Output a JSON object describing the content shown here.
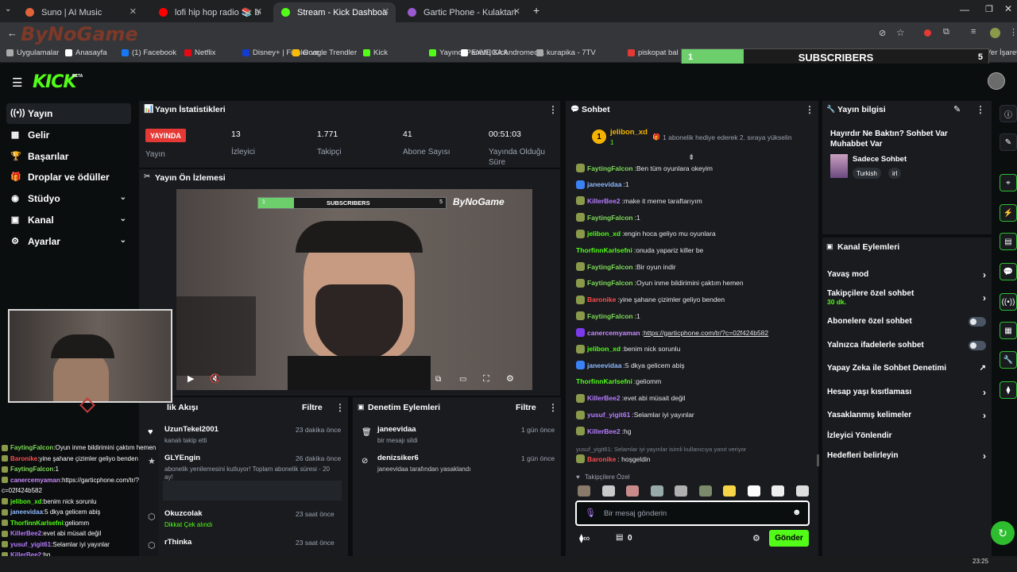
{
  "browser": {
    "tabs": [
      {
        "label": "Suno | AI Music",
        "color": "#e0633a"
      },
      {
        "label": "lofi hip hop radio 📚 beats",
        "color": "#ff0000"
      },
      {
        "label": "Stream - Kick Dashboard",
        "color": "#53fc18"
      },
      {
        "label": "Gartic Phone - Kulaktan Kulağa",
        "color": "#9b59d0"
      }
    ],
    "watermark": "ByNoGame",
    "bookmarks": [
      "Uygulamalar",
      "Anasayfa",
      "(1) Facebook",
      "Netflix",
      "Disney+ | Filmler ve...",
      "Google Trendler",
      "Kick",
      "Yayıncı Paneli | Kick",
      "EXVEGA Andromed...",
      "kurapika - 7TV",
      "piskopat bal pe...",
      "Gelecek ...",
      "Tüm Yer İşaretleri"
    ]
  },
  "sub_goal": {
    "current": "1",
    "label": "SUBSCRIBERS",
    "target": "5",
    "progress": 0.2
  },
  "nav": {
    "logo": "KICK",
    "beta": "BETA"
  },
  "sidebar": [
    {
      "label": "Yayın",
      "icon": "broadcast-icon",
      "glyph": "((•))",
      "active": true
    },
    {
      "label": "Gelir",
      "icon": "revenue-icon",
      "glyph": "▦"
    },
    {
      "label": "Başarılar",
      "icon": "trophy-icon",
      "glyph": "🏆"
    },
    {
      "label": "Droplar ve ödüller",
      "icon": "gift-icon",
      "glyph": "🎁"
    },
    {
      "label": "Stüdyo",
      "icon": "studio-icon",
      "glyph": "◉",
      "chev": true
    },
    {
      "label": "Kanal",
      "icon": "channel-icon",
      "glyph": "▣",
      "chev": true
    },
    {
      "label": "Ayarlar",
      "icon": "settings-icon",
      "glyph": "⚙",
      "chev": true
    }
  ],
  "stats": {
    "title": "Yayın İstatistikleri",
    "live_badge": "YAYINDA",
    "live_label": "Yayın",
    "items": [
      {
        "value": "13",
        "label": "İzleyici"
      },
      {
        "value": "1.771",
        "label": "Takipçi"
      },
      {
        "value": "41",
        "label": "Abone Sayısı"
      },
      {
        "value": "00:51:03",
        "label": "Yayında Olduğu Süre"
      }
    ]
  },
  "preview": {
    "title": "Yayın Ön İzlemesi"
  },
  "activity": {
    "title": "Etkinlik Akışı",
    "title_visible": "lik Akışı",
    "filter": "Filtre",
    "items": [
      {
        "name": "UzunTekel2001",
        "sub": "kanalı takip etti",
        "time": "23 dakika önce",
        "icon": "heart-icon"
      },
      {
        "name": "GLYEngin",
        "sub": "abonelik yenilemesini kutluyor! Toplam abonelik süresi - 20 ay!",
        "time": "26 dakika önce",
        "icon": "star-icon"
      },
      {
        "name": "Okuzcolak",
        "sub": "Dikkat Çek alındı",
        "time": "23 saat önce",
        "icon": "points-icon"
      },
      {
        "name": "rThinka",
        "sub": "",
        "time": "23 saat önce",
        "icon": "points-icon"
      }
    ]
  },
  "moderation": {
    "title": "Denetim Eylemleri",
    "filter": "Filtre",
    "items": [
      {
        "name": "janeevidaa",
        "sub": "bir mesajı sildi",
        "time": "1 gün önce",
        "icon": "trash-icon"
      },
      {
        "name": "denizsiker6",
        "sub": "janeevidaa tarafından yasaklandı",
        "time": "1 gün önce",
        "icon": "ban-icon"
      }
    ]
  },
  "chat": {
    "title": "Sohbet",
    "pinned_user": "jelibon_xd",
    "pinned_count": "1",
    "pinned_msg": "1 abonelik hediye ederek 2. sıraya yükselin",
    "messages": [
      {
        "user": "FaytingFalcon",
        "color": "#7ed957",
        "text": "Ben tüm oyunlara okeyim"
      },
      {
        "user": "janeevidaa",
        "color": "#8fb9ff",
        "text": "1"
      },
      {
        "user": "KillerBee2",
        "color": "#b77cff",
        "text": "make it meme taraftarıyım"
      },
      {
        "user": "FaytingFalcon",
        "color": "#7ed957",
        "text": "1"
      },
      {
        "user": "jelibon_xd",
        "color": "#53fc18",
        "text": "engin hoca geliyo mu oyunlara"
      },
      {
        "user": "ThorfinnKarlsefni",
        "color": "#53fc18",
        "text": "onuda yapariz killer be"
      },
      {
        "user": "FaytingFalcon",
        "color": "#7ed957",
        "text": "Bir oyun indir"
      },
      {
        "user": "FaytingFalcon",
        "color": "#7ed957",
        "text": "Oyun inme bildirimini çaktım hemen"
      },
      {
        "user": "Baronike",
        "color": "#ff4d4d",
        "text": "yine şahane çizimler geliyo benden"
      },
      {
        "user": "FaytingFalcon",
        "color": "#7ed957",
        "text": "1"
      },
      {
        "user": "canercemyaman",
        "color": "#c98bff",
        "text": "https://garticphone.com/tr/?c=02f424b582"
      },
      {
        "user": "jelibon_xd",
        "color": "#53fc18",
        "text": "benim nick sorunlu"
      },
      {
        "user": "janeevidaa",
        "color": "#8fb9ff",
        "text": "5 dkya gelicem abiş"
      },
      {
        "user": "ThorfinnKarlsefni",
        "color": "#53fc18",
        "text": "geliomm"
      },
      {
        "user": "KillerBee2",
        "color": "#b77cff",
        "text": "evet abi müsait değil"
      },
      {
        "user": "yusuf_yigit61",
        "color": "#b77cff",
        "text": "Selamlar iyi yayınlar"
      },
      {
        "user": "KillerBee2",
        "color": "#b77cff",
        "text": "hg"
      }
    ],
    "reply_note": "yusuf_yigit61: Selamlar iyi yayınlar isimli kullanıcıya yanıt veriyor",
    "last": {
      "user": "Baronike",
      "color": "#ff4d4d",
      "text": "hoşgeldin"
    },
    "emote_label": "Takipçilere Özel",
    "input_placeholder": "Bir mesaj gönderin",
    "points": "0",
    "send": "Gönder"
  },
  "stream_info": {
    "title": "Yayın bilgisi",
    "stream_title": "Hayırdır Ne Baktın? Sohbet Var Muhabbet Var",
    "category": "Sadece Sohbet",
    "tags": [
      "Turkish",
      "irl"
    ]
  },
  "channel_actions": {
    "title": "Kanal Eylemleri",
    "items": [
      {
        "label": "Yavaş mod",
        "type": "chev"
      },
      {
        "label": "Takipçilere özel sohbet",
        "sub": "30 dk.",
        "type": "chev"
      },
      {
        "label": "Abonelere özel sohbet",
        "type": "toggle"
      },
      {
        "label": "Yalnızca ifadelerle sohbet",
        "type": "toggle"
      },
      {
        "label": "Yapay Zeka ile Sohbet Denetimi",
        "type": "ext"
      },
      {
        "label": "Hesap yaşı kısıtlaması",
        "type": "chev"
      },
      {
        "label": "Yasaklanmış kelimeler",
        "type": "chev"
      },
      {
        "label": "İzleyici Yönlendir",
        "type": "none"
      },
      {
        "label": "Hedefleri belirleyin",
        "type": "chev"
      }
    ]
  },
  "overlay_chat": [
    {
      "user": "FaytingFalcon",
      "color": "#7ed957",
      "text": "Oyun inme bildirimini çaktım hemen"
    },
    {
      "user": "Baronike",
      "color": "#ff4d4d",
      "text": "yine şahane çizimler geliyo benden"
    },
    {
      "user": "FaytingFalcon",
      "color": "#7ed957",
      "text": "1"
    },
    {
      "user": "canercemyaman",
      "color": "#c98bff",
      "text": "https://garticphone.com/tr/?"
    },
    {
      "user": "",
      "color": "#fff",
      "text": "c=02f424b582"
    },
    {
      "user": "jelibon_xd",
      "color": "#53fc18",
      "text": "benim nick sorunlu"
    },
    {
      "user": "janeevidaa",
      "color": "#8fb9ff",
      "text": "5 dkya gelicem abiş"
    },
    {
      "user": "ThorfinnKarlsefni",
      "color": "#53fc18",
      "text": "geliomm"
    },
    {
      "user": "KillerBee2",
      "color": "#b77cff",
      "text": "evet abi müsait değil"
    },
    {
      "user": "yusuf_yigit61",
      "color": "#b77cff",
      "text": "Selamlar iyi yayınlar"
    },
    {
      "user": "KillerBee2",
      "color": "#b77cff",
      "text": "hg"
    },
    {
      "user": "Baronike",
      "color": "#ff4d4d",
      "text": "hoşgeldin"
    }
  ],
  "clock": "23:25",
  "colors": {
    "brand": "#53fc18",
    "live": "#e53935"
  }
}
